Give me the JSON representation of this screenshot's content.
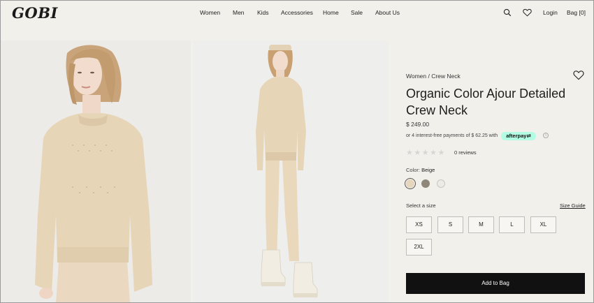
{
  "header": {
    "logo": "GOBI",
    "nav": [
      "Women",
      "Men",
      "Kids",
      "Accessories",
      "Home",
      "Sale",
      "About Us"
    ],
    "login_label": "Login",
    "bag_label": "Bag [0]",
    "icons": [
      "search-icon",
      "heart-icon"
    ]
  },
  "product": {
    "breadcrumb": "Women / Crew Neck",
    "title": "Organic Color Ajour Detailed Crew Neck",
    "price": "$ 249.00",
    "installments_text": "or 4 interest-free payments of $ 62.25 with",
    "afterpay_label": "afterpay",
    "rating_stars": 0,
    "reviews_label": "0 reviews",
    "color_label": "Color:",
    "color_value": "Beige",
    "swatches": [
      {
        "name": "Beige",
        "hex": "#e6d6bd",
        "selected": true
      },
      {
        "name": "Taupe",
        "hex": "#8e877a",
        "selected": false
      },
      {
        "name": "Off-white",
        "hex": "#ecebe6",
        "selected": false
      }
    ],
    "size_prompt": "Select a size",
    "size_guide_label": "Size Guide",
    "sizes": [
      "XS",
      "S",
      "M",
      "L",
      "XL",
      "2XL"
    ],
    "add_to_bag_label": "Add to Bag"
  },
  "colors": {
    "background": "#f2f0eb",
    "sweater": "#e7d5b8",
    "button": "#111111",
    "afterpay": "#b2fce4"
  }
}
